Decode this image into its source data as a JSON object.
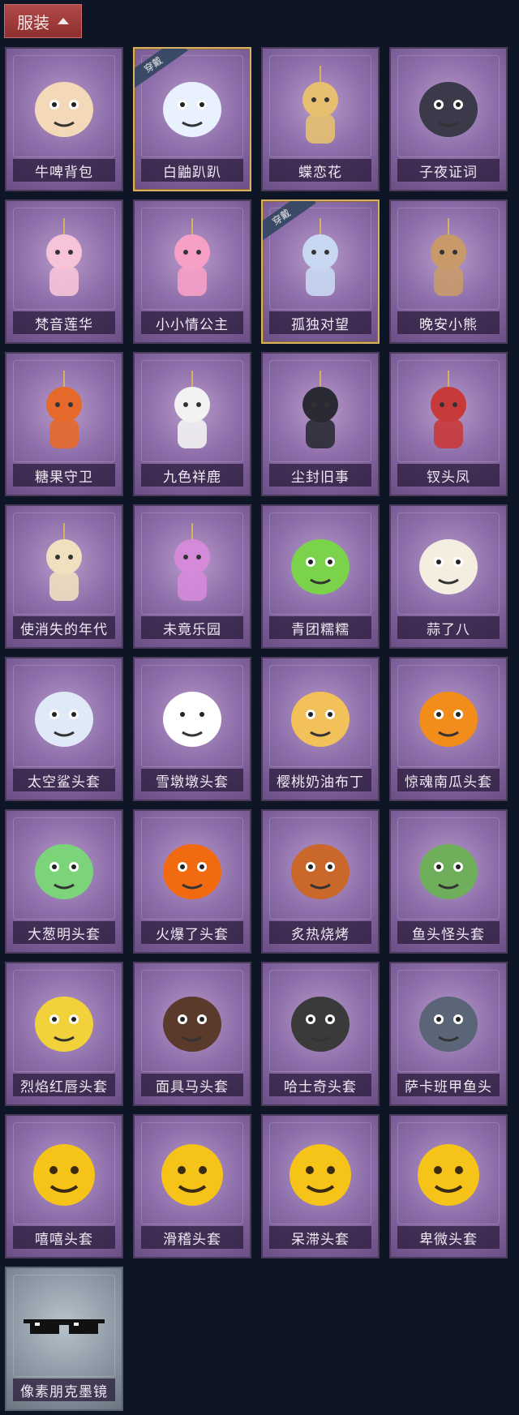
{
  "header": {
    "category_label": "服装",
    "icon": "chevron-up-icon"
  },
  "equipped_badge": "穿戴",
  "items": [
    {
      "name": "牛啤背包",
      "equipped": false,
      "frame": "purple",
      "icon": "cow-beer-backpack-icon"
    },
    {
      "name": "白鼬趴趴",
      "equipped": true,
      "frame": "purple",
      "icon": "white-ermine-icon"
    },
    {
      "name": "蝶恋花",
      "equipped": false,
      "frame": "purple",
      "icon": "butterfly-flower-pendant-icon"
    },
    {
      "name": "子夜证词",
      "equipped": false,
      "frame": "purple",
      "icon": "midnight-owl-icon"
    },
    {
      "name": "梵音莲华",
      "equipped": false,
      "frame": "purple",
      "icon": "lotus-doll-icon"
    },
    {
      "name": "小小情公主",
      "equipped": false,
      "frame": "purple",
      "icon": "little-princess-icon"
    },
    {
      "name": "孤独对望",
      "equipped": true,
      "frame": "purple",
      "icon": "lonely-gaze-doll-icon"
    },
    {
      "name": "晚安小熊",
      "equipped": false,
      "frame": "purple",
      "icon": "good-night-bear-icon"
    },
    {
      "name": "糖果守卫",
      "equipped": false,
      "frame": "purple",
      "icon": "candy-guard-pumpkin-icon"
    },
    {
      "name": "九色祥鹿",
      "equipped": false,
      "frame": "purple",
      "icon": "nine-color-deer-icon"
    },
    {
      "name": "尘封旧事",
      "equipped": false,
      "frame": "purple",
      "icon": "dusty-past-doll-icon"
    },
    {
      "name": "钗头凤",
      "equipped": false,
      "frame": "purple",
      "icon": "phoenix-hairpin-doll-icon"
    },
    {
      "name": "使消失的年代",
      "equipped": false,
      "frame": "purple",
      "icon": "vanished-era-doll-icon"
    },
    {
      "name": "未竟乐园",
      "equipped": false,
      "frame": "purple",
      "icon": "unfinished-paradise-doll-icon"
    },
    {
      "name": "青团糯糯",
      "equipped": false,
      "frame": "purple",
      "icon": "green-dumpling-icon"
    },
    {
      "name": "蒜了八",
      "equipped": false,
      "frame": "purple",
      "icon": "garlic-icon"
    },
    {
      "name": "太空鲨头套",
      "equipped": false,
      "frame": "purple",
      "icon": "space-shark-head-icon"
    },
    {
      "name": "雪墩墩头套",
      "equipped": false,
      "frame": "purple",
      "icon": "snowman-head-icon"
    },
    {
      "name": "樱桃奶油布丁",
      "equipped": false,
      "frame": "purple",
      "icon": "cherry-pudding-icon"
    },
    {
      "name": "惊魂南瓜头套",
      "equipped": false,
      "frame": "purple",
      "icon": "jack-o-lantern-icon"
    },
    {
      "name": "大葱明头套",
      "equipped": false,
      "frame": "purple",
      "icon": "scallion-head-icon"
    },
    {
      "name": "火爆了头套",
      "equipped": false,
      "frame": "purple",
      "icon": "fireball-head-icon"
    },
    {
      "name": "炙热烧烤",
      "equipped": false,
      "frame": "purple",
      "icon": "bbq-meat-icon"
    },
    {
      "name": "鱼头怪头套",
      "equipped": false,
      "frame": "purple",
      "icon": "fish-head-mask-icon"
    },
    {
      "name": "烈焰红唇头套",
      "equipped": false,
      "frame": "purple",
      "icon": "red-lips-mask-icon"
    },
    {
      "name": "面具马头套",
      "equipped": false,
      "frame": "purple",
      "icon": "horse-mask-icon"
    },
    {
      "name": "哈士奇头套",
      "equipped": false,
      "frame": "purple",
      "icon": "husky-mask-icon"
    },
    {
      "name": "萨卡班甲鱼头",
      "equipped": false,
      "frame": "purple",
      "icon": "sacabambaspis-icon"
    },
    {
      "name": "嘻嘻头套",
      "equipped": false,
      "frame": "purple",
      "icon": "grin-emoji-head-icon"
    },
    {
      "name": "滑稽头套",
      "equipped": false,
      "frame": "purple",
      "icon": "smirk-emoji-head-icon"
    },
    {
      "name": "呆滞头套",
      "equipped": false,
      "frame": "purple",
      "icon": "dazed-emoji-head-icon"
    },
    {
      "name": "卑微头套",
      "equipped": false,
      "frame": "purple",
      "icon": "humble-emoji-head-icon"
    },
    {
      "name": "像素朋克墨镜",
      "equipped": false,
      "frame": "grey",
      "icon": "pixel-sunglasses-icon"
    }
  ],
  "colors": {
    "background": "#0e1525",
    "header": "#9c3a3a",
    "card_purple": "#8e6fab",
    "card_grey": "#8e9ba6",
    "equipped_border": "#d8b060"
  }
}
